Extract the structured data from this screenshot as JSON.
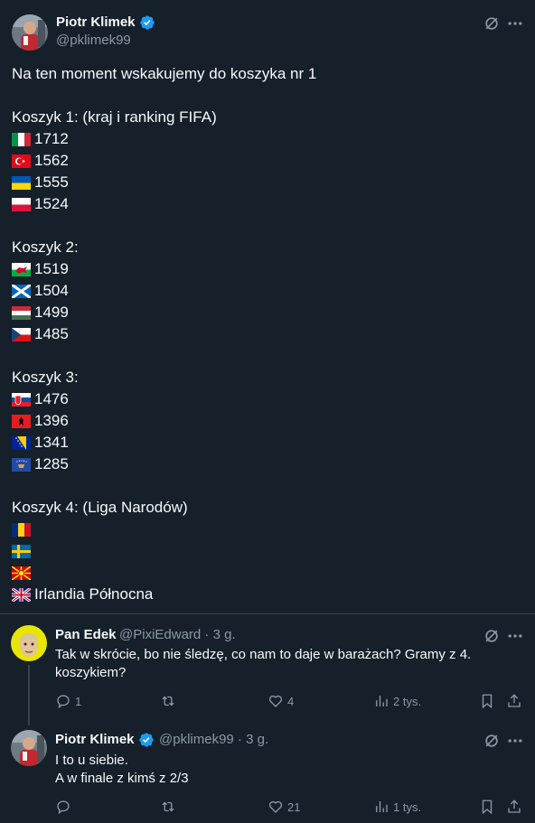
{
  "main_post": {
    "author_name": "Piotr Klimek",
    "handle": "@pklimek99",
    "intro": "Na ten moment wskakujemy do koszyka nr 1",
    "groups": [
      {
        "title": "Koszyk 1: (kraj i ranking FIFA)",
        "items": [
          {
            "flag": "italy-flag",
            "value": "1712"
          },
          {
            "flag": "turkey-flag",
            "value": "1562"
          },
          {
            "flag": "ukraine-flag",
            "value": "1555"
          },
          {
            "flag": "poland-flag",
            "value": "1524"
          }
        ]
      },
      {
        "title": "Koszyk 2:",
        "items": [
          {
            "flag": "wales-flag",
            "value": "1519"
          },
          {
            "flag": "scotland-flag",
            "value": "1504"
          },
          {
            "flag": "hungary-flag",
            "value": "1499"
          },
          {
            "flag": "czechia-flag",
            "value": "1485"
          }
        ]
      },
      {
        "title": "Koszyk 3:",
        "items": [
          {
            "flag": "slovakia-flag",
            "value": "1476"
          },
          {
            "flag": "albania-flag",
            "value": "1396"
          },
          {
            "flag": "bosnia-flag",
            "value": "1341"
          },
          {
            "flag": "kosovo-flag",
            "value": "1285"
          }
        ]
      },
      {
        "title": "Koszyk 4: (Liga Narodów)",
        "items": [
          {
            "flag": "romania-flag",
            "value": ""
          },
          {
            "flag": "sweden-flag",
            "value": ""
          },
          {
            "flag": "north-macedonia-flag",
            "value": ""
          },
          {
            "flag": "uk-flag",
            "value": "Irlandia Północna"
          }
        ]
      }
    ]
  },
  "replies": [
    {
      "author_name": "Pan Edek",
      "meta": "@PixiEdward · 3 g.",
      "text_lines": [
        "Tak w skrócie, bo nie śledzę, co nam to daje w barażach? Gramy z 4.",
        "koszykiem?"
      ],
      "replies_count": "1",
      "reposts_count": "",
      "likes_count": "4",
      "views_count": "2 tys."
    },
    {
      "author_name": "Piotr Klimek",
      "meta": "@pklimek99 · 3 g.",
      "text_lines": [
        "I to u siebie.",
        "A w finale z kimś z 2/3"
      ],
      "replies_count": "",
      "reposts_count": "",
      "likes_count": "21",
      "views_count": "1 tys."
    }
  ],
  "colors": {
    "background": "#15202b",
    "text": "#f7f9f9",
    "secondary_text": "#8b98a5",
    "divider": "#38444d",
    "verified": "#1d9bf0"
  }
}
